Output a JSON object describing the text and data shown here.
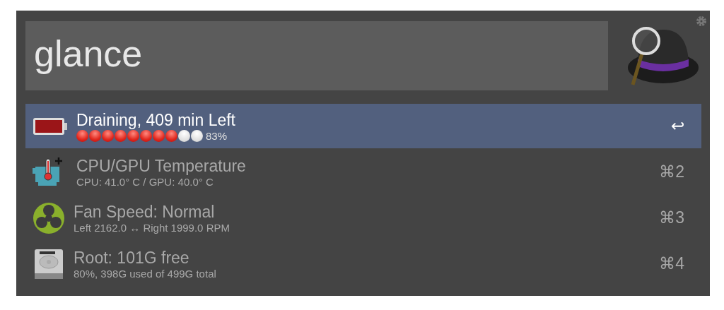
{
  "search": {
    "value": "glance"
  },
  "results": [
    {
      "kind": "battery",
      "title": "Draining, 409 min Left",
      "stars": 8,
      "subtitle": "83%",
      "shortcut": "↩",
      "selected": true
    },
    {
      "kind": "thermometer",
      "title": "CPU/GPU Temperature",
      "subtitle": "CPU: 41.0° C / GPU: 40.0° C",
      "shortcut": "⌘2",
      "selected": false
    },
    {
      "kind": "fan",
      "title": "Fan Speed: Normal",
      "subtitle": "Left 2162.0 ↔ Right 1999.0 RPM",
      "shortcut": "⌘3",
      "selected": false
    },
    {
      "kind": "disk",
      "title": "Root: 101G free",
      "subtitle": "80%, 398G used of 499G total",
      "shortcut": "⌘4",
      "selected": false
    }
  ]
}
